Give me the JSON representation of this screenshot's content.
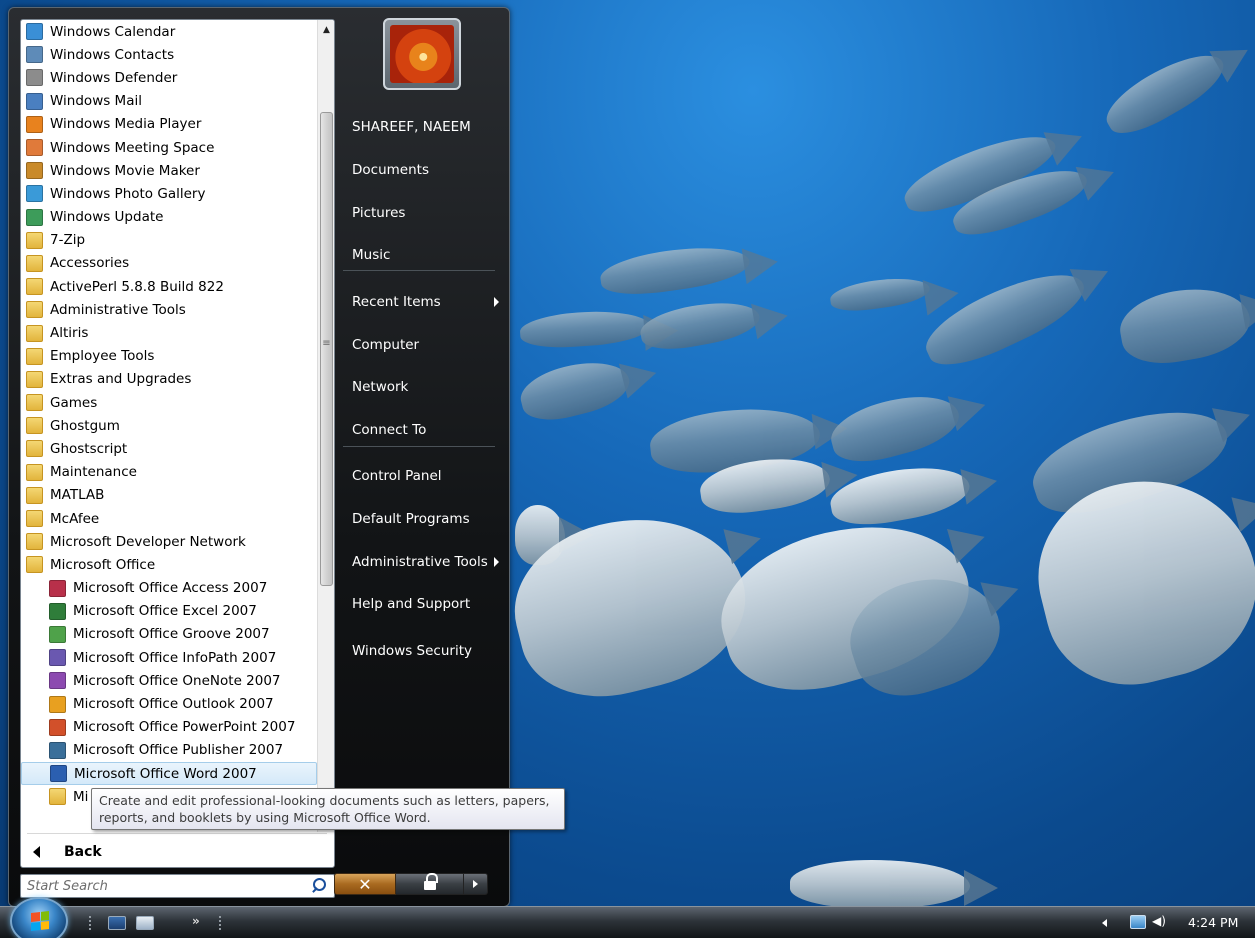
{
  "desktop": {
    "wallpaper": "underwater fish"
  },
  "programs": {
    "items": [
      {
        "label": "Windows Calendar",
        "icon": "calendar-icon",
        "color": "#3a8fd6",
        "sub": false
      },
      {
        "label": "Windows Contacts",
        "icon": "contacts-icon",
        "color": "#5e8bb8",
        "sub": false
      },
      {
        "label": "Windows Defender",
        "icon": "defender-icon",
        "color": "#8c8c8c",
        "sub": false
      },
      {
        "label": "Windows Mail",
        "icon": "mail-icon",
        "color": "#4a7fc0",
        "sub": false
      },
      {
        "label": "Windows Media Player",
        "icon": "media-player-icon",
        "color": "#e8821e",
        "sub": false
      },
      {
        "label": "Windows Meeting Space",
        "icon": "meeting-space-icon",
        "color": "#e07a3a",
        "sub": false
      },
      {
        "label": "Windows Movie Maker",
        "icon": "movie-maker-icon",
        "color": "#c98a2a",
        "sub": false
      },
      {
        "label": "Windows Photo Gallery",
        "icon": "photo-gallery-icon",
        "color": "#3a9ad8",
        "sub": false
      },
      {
        "label": "Windows Update",
        "icon": "update-icon",
        "color": "#3d9c5a",
        "sub": false
      },
      {
        "label": "7-Zip",
        "icon": "folder-icon",
        "folder": true,
        "sub": false
      },
      {
        "label": "Accessories",
        "icon": "folder-icon",
        "folder": true,
        "sub": false
      },
      {
        "label": "ActivePerl 5.8.8 Build 822",
        "icon": "folder-icon",
        "folder": true,
        "sub": false
      },
      {
        "label": "Administrative Tools",
        "icon": "folder-icon",
        "folder": true,
        "sub": false
      },
      {
        "label": "Altiris",
        "icon": "folder-icon",
        "folder": true,
        "sub": false
      },
      {
        "label": "Employee Tools",
        "icon": "folder-icon",
        "folder": true,
        "sub": false
      },
      {
        "label": "Extras and Upgrades",
        "icon": "folder-icon",
        "folder": true,
        "sub": false
      },
      {
        "label": "Games",
        "icon": "folder-icon",
        "folder": true,
        "sub": false
      },
      {
        "label": "Ghostgum",
        "icon": "folder-icon",
        "folder": true,
        "sub": false
      },
      {
        "label": "Ghostscript",
        "icon": "folder-icon",
        "folder": true,
        "sub": false
      },
      {
        "label": "Maintenance",
        "icon": "folder-icon",
        "folder": true,
        "sub": false
      },
      {
        "label": "MATLAB",
        "icon": "folder-icon",
        "folder": true,
        "sub": false
      },
      {
        "label": "McAfee",
        "icon": "folder-icon",
        "folder": true,
        "sub": false
      },
      {
        "label": "Microsoft Developer Network",
        "icon": "folder-icon",
        "folder": true,
        "sub": false
      },
      {
        "label": "Microsoft Office",
        "icon": "folder-icon",
        "folder": true,
        "sub": false
      },
      {
        "label": "Microsoft Office Access 2007",
        "icon": "access-icon",
        "color": "#b8304a",
        "sub": true
      },
      {
        "label": "Microsoft Office Excel 2007",
        "icon": "excel-icon",
        "color": "#2f7d3a",
        "sub": true
      },
      {
        "label": "Microsoft Office Groove 2007",
        "icon": "groove-icon",
        "color": "#4fa24a",
        "sub": true
      },
      {
        "label": "Microsoft Office InfoPath 2007",
        "icon": "infopath-icon",
        "color": "#6a58b0",
        "sub": true
      },
      {
        "label": "Microsoft Office OneNote 2007",
        "icon": "onenote-icon",
        "color": "#8c4ab0",
        "sub": true
      },
      {
        "label": "Microsoft Office Outlook 2007",
        "icon": "outlook-icon",
        "color": "#e8a020",
        "sub": true
      },
      {
        "label": "Microsoft Office PowerPoint 2007",
        "icon": "powerpoint-icon",
        "color": "#d2502a",
        "sub": true
      },
      {
        "label": "Microsoft Office Publisher 2007",
        "icon": "publisher-icon",
        "color": "#3a6f9a",
        "sub": true
      },
      {
        "label": "Microsoft Office Word 2007",
        "icon": "word-icon",
        "color": "#2b5fb0",
        "sub": true,
        "selected": true
      },
      {
        "label": "Mi",
        "icon": "folder-icon",
        "folder": true,
        "sub": true
      }
    ],
    "back_label": "Back"
  },
  "search": {
    "placeholder": "Start Search"
  },
  "right_pane": {
    "user_name": "SHAREEF, NAEEM",
    "items": [
      {
        "label": "Documents"
      },
      {
        "label": "Pictures"
      },
      {
        "label": "Music"
      },
      {
        "label": "Recent Items",
        "submenu": true
      },
      {
        "label": "Computer"
      },
      {
        "label": "Network"
      },
      {
        "label": "Connect To"
      },
      {
        "label": "Control Panel"
      },
      {
        "label": "Default Programs"
      },
      {
        "label": "Administrative Tools",
        "submenu": true
      },
      {
        "label": "Help and Support"
      },
      {
        "label": "Windows Security"
      }
    ]
  },
  "power": {
    "shutdown_glyph": "✕"
  },
  "tooltip": {
    "line1": "Create and edit professional-looking documents such as letters, papers,",
    "line2": "reports, and booklets by using Microsoft Office Word."
  },
  "taskbar": {
    "clock": "4:24 PM",
    "more_glyph": "»"
  }
}
